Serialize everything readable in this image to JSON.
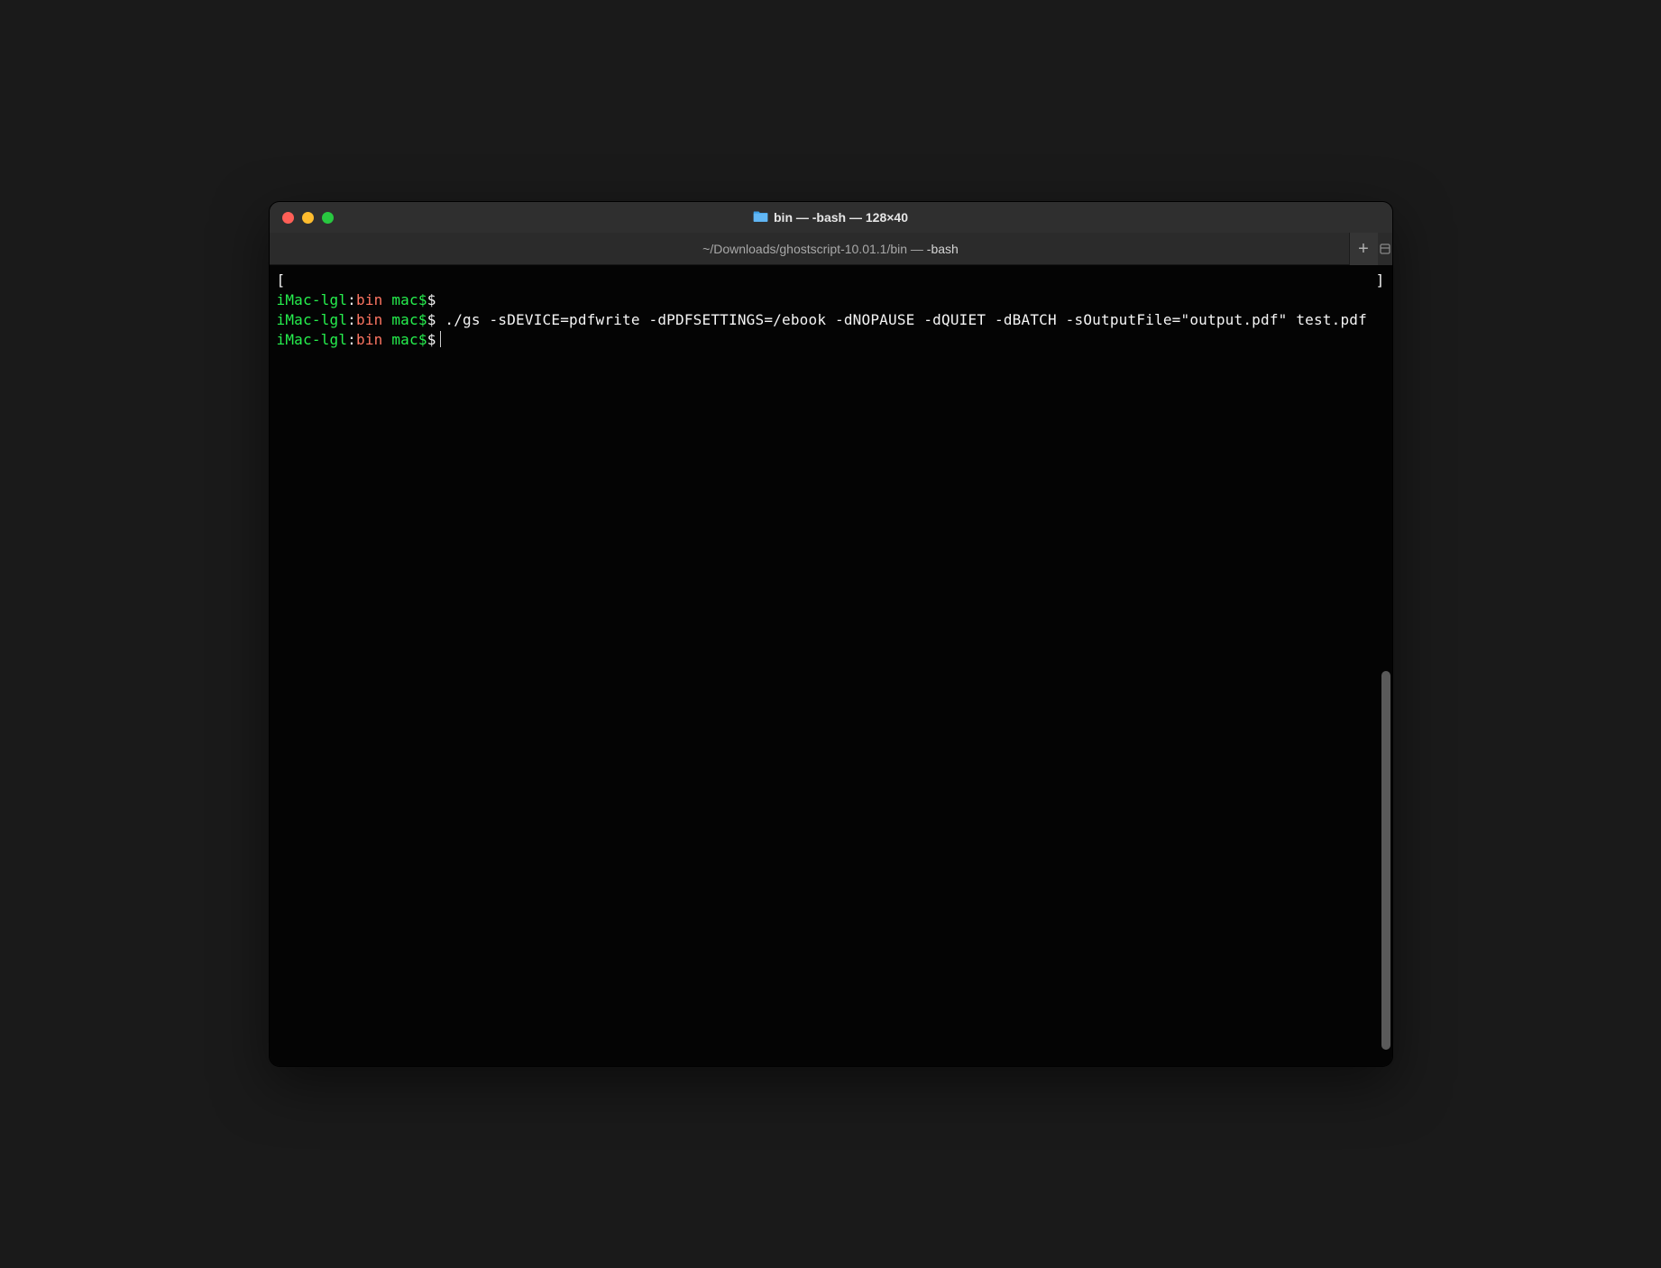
{
  "titlebar": {
    "title": "bin — -bash — 128×40"
  },
  "tabbar": {
    "path": "~/Downloads/ghostscript-10.01.1/bin — ",
    "shell": "-bash",
    "add_label": "+"
  },
  "terminal": {
    "bracket_open": "[",
    "bracket_close": "]",
    "lines": [
      {
        "host": "iMac-lgl",
        "colon": ":",
        "dir": "bin",
        "user": " mac$",
        "dollar": "$",
        "cmd": ""
      },
      {
        "host": "iMac-lgl",
        "colon": ":",
        "dir": "bin",
        "user": " mac$",
        "dollar": "$",
        "cmd": " ./gs -sDEVICE=pdfwrite -dPDFSETTINGS=/ebook -dNOPAUSE -dQUIET -dBATCH -sOutputFile=\"output.pdf\" test.pdf"
      },
      {
        "host": "iMac-lgl",
        "colon": ":",
        "dir": "bin",
        "user": " mac$",
        "dollar": "$",
        "cmd": ""
      }
    ]
  }
}
